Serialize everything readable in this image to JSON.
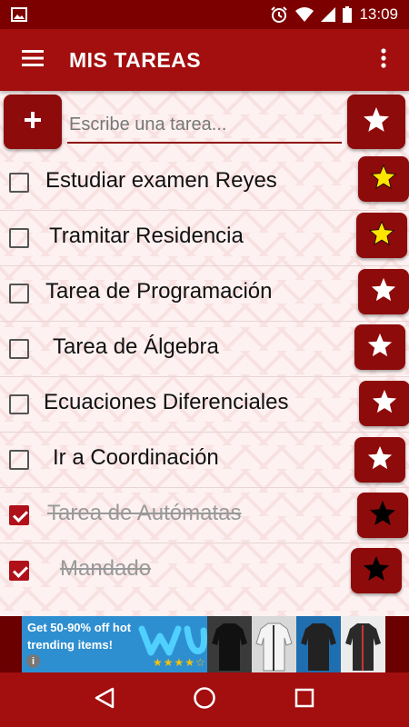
{
  "status_bar": {
    "time": "13:09",
    "icons": [
      "image-icon",
      "alarm-icon",
      "wifi-icon",
      "signal-icon",
      "battery-icon"
    ]
  },
  "app_bar": {
    "title": "MIS TAREAS",
    "menu_icon": "hamburger-menu-icon",
    "overflow_icon": "more-vert-icon"
  },
  "input": {
    "placeholder": "Escribe una tarea...",
    "value": "",
    "add_icon": "plus-icon",
    "favorite_icon": "star-icon"
  },
  "tasks": [
    {
      "label": "Estudiar examen Reyes",
      "done": false,
      "starred": true
    },
    {
      "label": "Tramitar Residencia",
      "done": false,
      "starred": true
    },
    {
      "label": "Tarea de Programación",
      "done": false,
      "starred": false
    },
    {
      "label": "Tarea de Álgebra",
      "done": false,
      "starred": false
    },
    {
      "label": "Ecuaciones Diferenciales",
      "done": false,
      "starred": false
    },
    {
      "label": "Ir a Coordinación",
      "done": false,
      "starred": false
    },
    {
      "label": "Tarea de Autómatas",
      "done": true,
      "starred": false
    },
    {
      "label": "Mandado",
      "done": true,
      "starred": false
    }
  ],
  "ad": {
    "text": "Get 50-90% off hot trending items!",
    "rating_stars": 4.5
  },
  "nav_bar": {
    "icons": [
      "back-icon",
      "home-icon",
      "recents-icon"
    ]
  },
  "colors": {
    "primary": "#a30e0e",
    "primary_dark": "#7d0000",
    "button": "#8e0b0b",
    "star_yellow": "#ffe400",
    "star_white": "#ffffff",
    "star_black": "#000000",
    "checkbox_checked": "#b0101a"
  }
}
